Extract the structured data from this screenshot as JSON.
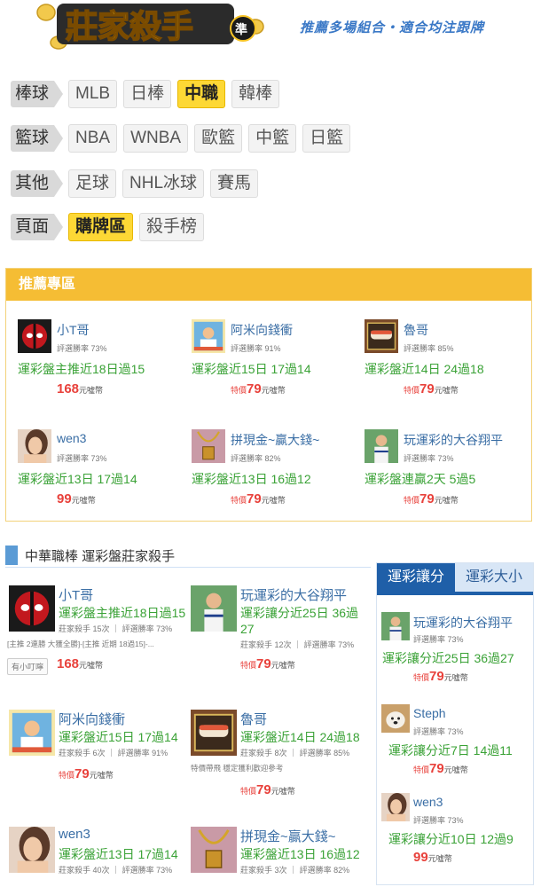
{
  "header": {
    "logo_text": "莊家殺手",
    "logo_badge": "準",
    "slogan": "推薦多場組合・適合均注跟牌"
  },
  "nav": [
    {
      "head": "棒球",
      "items": [
        {
          "label": "MLB",
          "active": false
        },
        {
          "label": "日棒",
          "active": false
        },
        {
          "label": "中職",
          "active": true
        },
        {
          "label": "韓棒",
          "active": false
        }
      ]
    },
    {
      "head": "籃球",
      "items": [
        {
          "label": "NBA",
          "active": false
        },
        {
          "label": "WNBA",
          "active": false
        },
        {
          "label": "歐籃",
          "active": false
        },
        {
          "label": "中籃",
          "active": false
        },
        {
          "label": "日籃",
          "active": false
        }
      ]
    },
    {
      "head": "其他",
      "items": [
        {
          "label": "足球",
          "active": false
        },
        {
          "label": "NHL冰球",
          "active": false
        },
        {
          "label": "賽馬",
          "active": false
        }
      ]
    },
    {
      "head": "頁面",
      "items": [
        {
          "label": "購牌區",
          "active": true
        },
        {
          "label": "殺手榜",
          "active": false
        }
      ]
    }
  ],
  "recommend": {
    "title": "推薦專區",
    "rate_label": "評選勝率",
    "unit": "元噓幣",
    "special": "特價",
    "cards": [
      {
        "name": "小T哥",
        "rate": "73%",
        "pick": "運彩盤主推近18日過15",
        "price": "168",
        "special": false,
        "avatar": "deadpool"
      },
      {
        "name": "阿米向錢衝",
        "rate": "91%",
        "pick": "運彩盤近15日 17過14",
        "price": "79",
        "special": true,
        "avatar": "card"
      },
      {
        "name": "魯哥",
        "rate": "85%",
        "pick": "運彩盤近14日 24過18",
        "price": "79",
        "special": true,
        "avatar": "sushi"
      },
      {
        "name": "wen3",
        "rate": "73%",
        "pick": "運彩盤近13日 17過14",
        "price": "99",
        "special": false,
        "avatar": "girl"
      },
      {
        "name": "拼現金~贏大錢~",
        "rate": "82%",
        "pick": "運彩盤近13日 16過12",
        "price": "79",
        "special": true,
        "avatar": "necklace"
      },
      {
        "name": "玩運彩的大谷翔平",
        "rate": "73%",
        "pick": "運彩盤連贏2天 5過5",
        "price": "79",
        "special": true,
        "avatar": "player"
      }
    ]
  },
  "section": {
    "title": "中華職棒  運彩盤莊家殺手",
    "killer_label": "莊家殺手",
    "rate_label": "評選勝率",
    "unit": "元噓幣",
    "special": "特價",
    "cards": [
      {
        "name": "小T哥",
        "pick": "運彩盤主推近18日過15",
        "count": "15次",
        "rate": "73%",
        "note": "[主推 2連勝 大獲全勝]-[主推 近期 18過15]-...",
        "badge": "有小叮嚀",
        "price": "168",
        "special": false,
        "avatar": "deadpool"
      },
      {
        "name": "玩運彩的大谷翔平",
        "pick": "運彩讓分近25日 36過27",
        "count": "12次",
        "rate": "73%",
        "note": "",
        "badge": "",
        "price": "79",
        "special": true,
        "avatar": "player"
      },
      {
        "name": "阿米向錢衝",
        "pick": "運彩盤近15日 17過14",
        "count": "6次",
        "rate": "91%",
        "note": "",
        "badge": "",
        "price": "79",
        "special": true,
        "avatar": "card"
      },
      {
        "name": "魯哥",
        "pick": "運彩盤近14日 24過18",
        "count": "8次",
        "rate": "85%",
        "note": "特價帶飛 穩定獲利歡迎參考",
        "badge": "",
        "price": "79",
        "special": true,
        "avatar": "sushi"
      },
      {
        "name": "wen3",
        "pick": "運彩盤近13日 17過14",
        "count": "40次",
        "rate": "73%",
        "note": "",
        "badge": "",
        "price": "",
        "special": false,
        "avatar": "girl"
      },
      {
        "name": "拼現金~贏大錢~",
        "pick": "運彩盤近13日 16過12",
        "count": "3次",
        "rate": "82%",
        "note": "",
        "badge": "",
        "price": "",
        "special": false,
        "avatar": "necklace"
      }
    ]
  },
  "sidebar": {
    "tabs": [
      {
        "label": "運彩讓分",
        "active": true
      },
      {
        "label": "運彩大小",
        "active": false
      }
    ],
    "rate_label": "評選勝率",
    "unit": "元噓幣",
    "special": "特價",
    "items": [
      {
        "name": "玩運彩的大谷翔平",
        "rate": "73%",
        "pick": "運彩讓分近25日 36過27",
        "price": "79",
        "special": true,
        "avatar": "player"
      },
      {
        "name": "Steph",
        "rate": "73%",
        "pick": "運彩讓分近7日 14過11",
        "price": "79",
        "special": true,
        "avatar": "dog"
      },
      {
        "name": "wen3",
        "rate": "73%",
        "pick": "運彩讓分近10日 12過9",
        "price": "99",
        "special": false,
        "avatar": "girl"
      }
    ]
  },
  "colors": {
    "accent": "#f5bd34",
    "active_nav": "#fdd835",
    "name": "#3a6ea5",
    "pick": "#3aa236",
    "price": "#e8413b",
    "tab": "#1f5fa8"
  }
}
